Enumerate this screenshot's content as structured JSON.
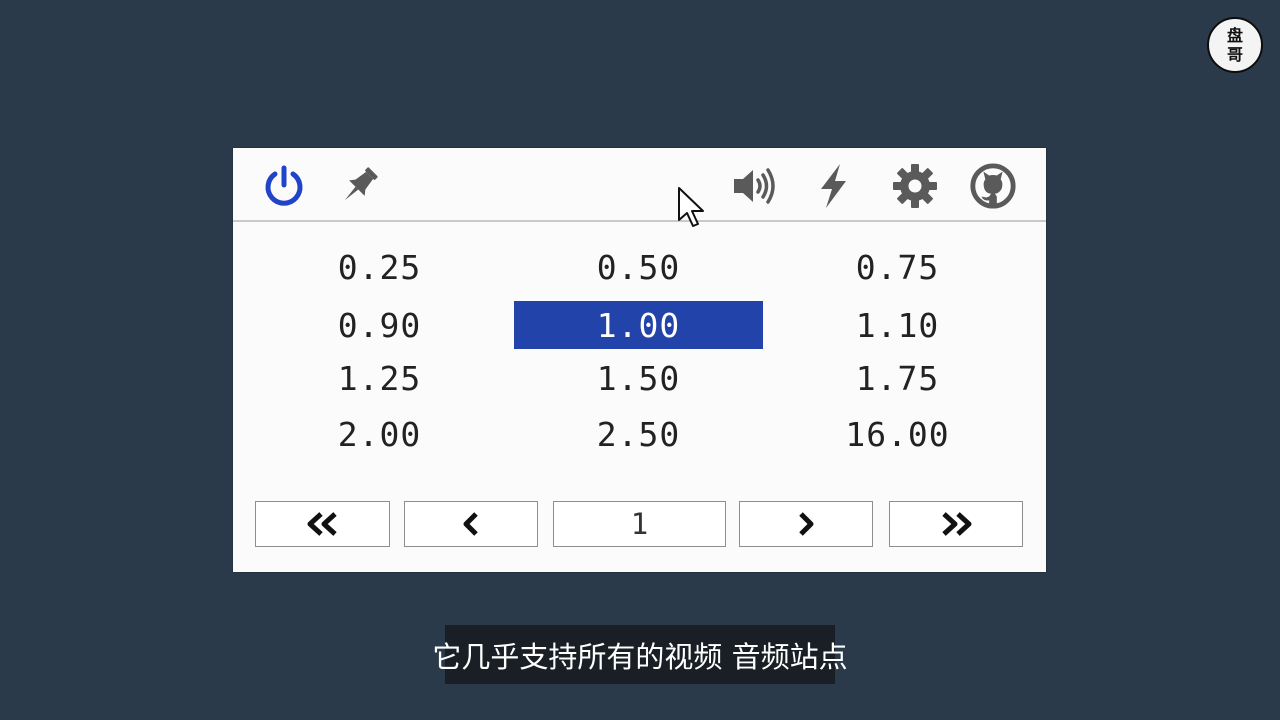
{
  "watermark": {
    "line1": "盘",
    "line2": "哥"
  },
  "toolbar": {
    "icons": [
      "power-icon",
      "pin-icon",
      "volume-icon",
      "bolt-icon",
      "gear-icon",
      "github-icon"
    ],
    "colors": {
      "power": "#2143c8",
      "inactive": "#5a5a5a"
    }
  },
  "speeds": {
    "rows": [
      [
        "0.25",
        "0.50",
        "0.75"
      ],
      [
        "0.90",
        "1.00",
        "1.10"
      ],
      [
        "1.25",
        "1.50",
        "1.75"
      ],
      [
        "2.00",
        "2.50",
        "16.00"
      ]
    ],
    "selected": "1.00",
    "selected_color": "#2143aa"
  },
  "pagination": {
    "first": "«",
    "prev": "‹",
    "page": "1",
    "next": "›",
    "last": "»"
  },
  "subtitle": "它几乎支持所有的视频 音频站点"
}
